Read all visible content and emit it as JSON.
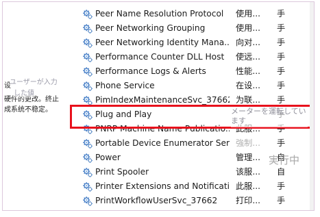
{
  "left_panel": {
    "line1": "设",
    "line2": "硬件的更改。终止",
    "line3": "成系统不稳定。"
  },
  "overlay_tips": {
    "left_line1": "ユーザーが入力",
    "left_line2": "した値",
    "center": "メーターを運転しています",
    "running": "実行中"
  },
  "services": [
    {
      "name": "Peer Name Resolution Protocol",
      "desc": "使用...",
      "start": "手"
    },
    {
      "name": "Peer Networking Grouping",
      "desc": "使用...",
      "start": "手"
    },
    {
      "name": "Peer Networking Identity Mana...",
      "desc": "向对...",
      "start": "手"
    },
    {
      "name": "Performance Counter DLL Host",
      "desc": "使远...",
      "start": "手"
    },
    {
      "name": "Performance Logs & Alerts",
      "desc": "性能...",
      "start": "手"
    },
    {
      "name": "Phone Service",
      "desc": "在设...",
      "start": "手"
    },
    {
      "name": "PimIndexMaintenanceSvc_37662",
      "desc": "为联...",
      "start": "手"
    },
    {
      "name": "Plug and Play",
      "desc": "",
      "start": "手"
    },
    {
      "name": "PNRP Machine Name Publicatio...",
      "desc": "此服...",
      "start": "手"
    },
    {
      "name": "Portable Device Enumerator Ser...",
      "desc": "強制...",
      "start": "手"
    },
    {
      "name": "Power",
      "desc": "管理...",
      "start": "自"
    },
    {
      "name": "Print Spooler",
      "desc": "该服...",
      "start": "自"
    },
    {
      "name": "Printer Extensions and Notificati...",
      "desc": "此服...",
      "start": "手"
    },
    {
      "name": "PrintWorkflowUserSvc_37662",
      "desc": "打印...",
      "start": "手"
    }
  ]
}
